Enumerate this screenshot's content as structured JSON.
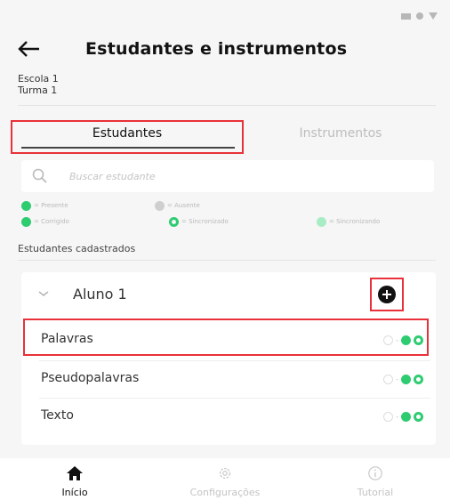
{
  "header": {
    "title": "Estudantes e instrumentos"
  },
  "info": {
    "school": "Escola 1",
    "class": "Turma 1"
  },
  "tabs": [
    {
      "label": "Estudantes",
      "active": true
    },
    {
      "label": "Instrumentos",
      "active": false
    }
  ],
  "search": {
    "placeholder": "Buscar estudante"
  },
  "legend": {
    "row1": [
      {
        "label": "= Presente",
        "color": "#2ecc71",
        "style": "filled"
      },
      {
        "label": "= Ausente",
        "color": "#cfcfcf",
        "style": "filled"
      }
    ],
    "row2": [
      {
        "label": "= Corrigido",
        "color": "#2ecc71",
        "style": "filled-check"
      },
      {
        "label": "= Sincronizado",
        "color": "#2ecc71",
        "style": "ring"
      },
      {
        "label": "= Sincronizando",
        "color": "#a8ecc6",
        "style": "filled"
      }
    ]
  },
  "section_label": "Estudantes cadastrados",
  "student": {
    "name": "Aluno 1",
    "instruments": [
      {
        "name": "Palavras",
        "status": "-"
      },
      {
        "name": "Pseudopalavras",
        "status": "-"
      },
      {
        "name": "Texto",
        "status": "-"
      }
    ]
  },
  "nav": [
    {
      "label": "Início",
      "icon": "home-icon",
      "active": true
    },
    {
      "label": "Configurações",
      "icon": "gear-icon",
      "active": false
    },
    {
      "label": "Tutorial",
      "icon": "info-icon",
      "active": false
    }
  ],
  "colors": {
    "accent": "#2ecc71",
    "highlight": "#e8313a",
    "inactive": "#bdbdbd"
  }
}
